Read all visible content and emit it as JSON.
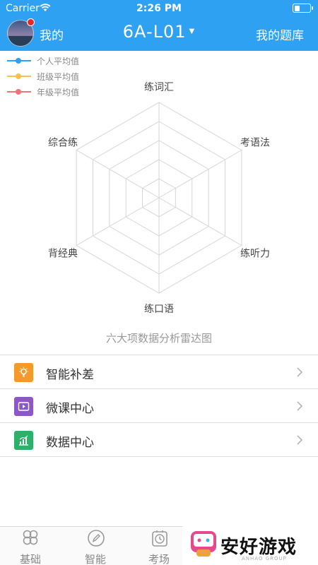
{
  "status_bar": {
    "carrier": "Carrier",
    "time": "2:26 PM"
  },
  "nav": {
    "left_label": "我的",
    "title": "6A-L01",
    "right_label": "我的题库"
  },
  "legend": [
    {
      "label": "个人平均值",
      "color": "#2FA1F2"
    },
    {
      "label": "班级平均值",
      "color": "#F5C24C"
    },
    {
      "label": "年级平均值",
      "color": "#F0747A"
    }
  ],
  "radar": {
    "axes": [
      "练词汇",
      "考语法",
      "练听力",
      "练口语",
      "背经典",
      "综合练"
    ],
    "caption": "六大项数据分析雷达图"
  },
  "menu": [
    {
      "label": "智能补差",
      "icon": "lightbulb-icon",
      "color": "#F39A2B"
    },
    {
      "label": "微课中心",
      "icon": "video-icon",
      "color": "#8E57C9"
    },
    {
      "label": "数据中心",
      "icon": "bar-chart-icon",
      "color": "#2DB06A"
    }
  ],
  "tabs": [
    {
      "label": "基础",
      "icon": "clover-icon"
    },
    {
      "label": "智能",
      "icon": "pencil-circle-icon"
    },
    {
      "label": "考场",
      "icon": "clock-icon"
    }
  ],
  "watermark": {
    "text": "安好游戏",
    "sub": "ANHAO GROUP"
  }
}
